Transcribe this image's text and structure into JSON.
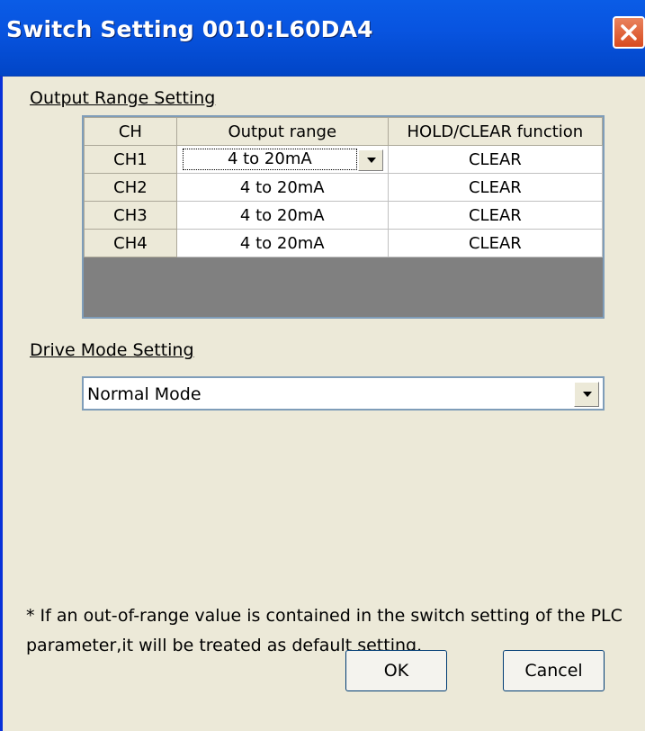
{
  "window": {
    "title": "Switch Setting 0010:L60DA4"
  },
  "output_range": {
    "group_label": "Output Range Setting",
    "columns": [
      "CH",
      "Output range",
      "HOLD/CLEAR function"
    ],
    "rows": [
      {
        "ch": "CH1",
        "range": "4 to 20mA",
        "hold": "CLEAR"
      },
      {
        "ch": "CH2",
        "range": "4 to 20mA",
        "hold": "CLEAR"
      },
      {
        "ch": "CH3",
        "range": "4 to 20mA",
        "hold": "CLEAR"
      },
      {
        "ch": "CH4",
        "range": "4 to 20mA",
        "hold": "CLEAR"
      }
    ]
  },
  "drive_mode": {
    "label": "Drive Mode Setting",
    "value": "Normal Mode"
  },
  "note": "* If an out-of-range value is contained in the switch setting of the PLC parameter,it will be treated as default setting.",
  "buttons": {
    "ok": "OK",
    "cancel": "Cancel"
  },
  "colors": {
    "title_bar": "#0854e0",
    "dialog_bg": "#ece9d8",
    "close_button": "#d84a1e"
  }
}
